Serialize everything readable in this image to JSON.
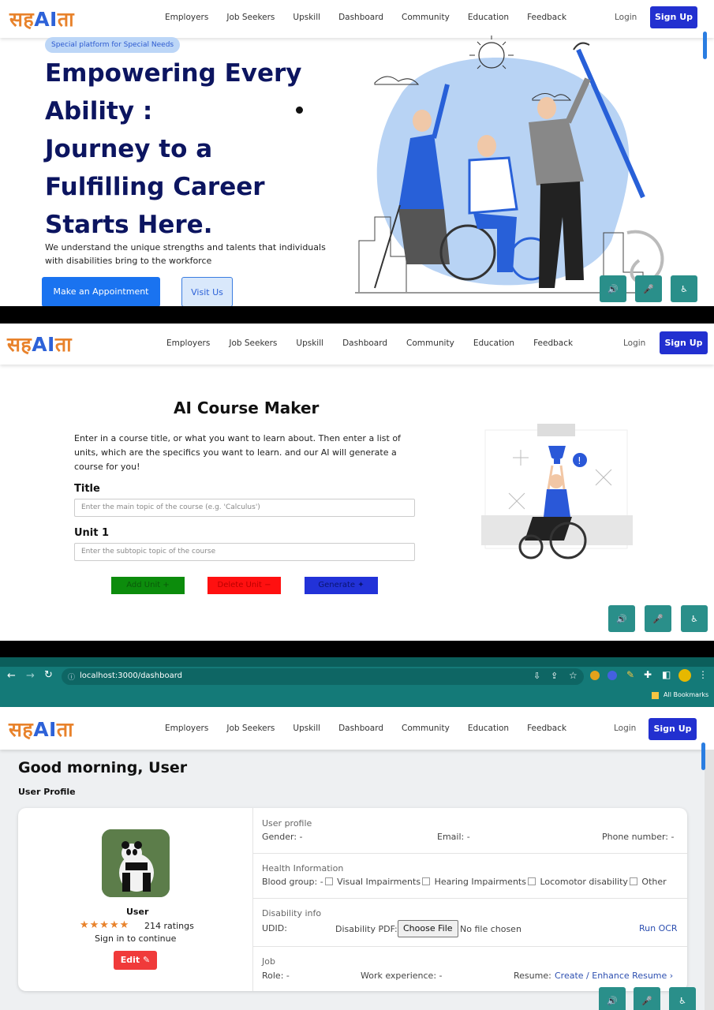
{
  "logo": {
    "part1": "सह",
    "part2": "AI",
    "part3": "ता"
  },
  "nav": {
    "items": [
      "Employers",
      "Job Seekers",
      "Upskill",
      "Dashboard",
      "Community",
      "Education",
      "Feedback"
    ],
    "login": "Login",
    "signup": "Sign Up"
  },
  "hero": {
    "badge": "Special platform for Special Needs",
    "title_lines": [
      "Empowering Every",
      "Ability :",
      "Journey to a",
      "Fulfilling Career",
      "Starts Here."
    ],
    "subtitle_line1": "We understand the unique strengths and talents that individuals",
    "subtitle_line2": "with disabilities bring to the workforce",
    "cta_primary": "Make an Appointment",
    "cta_secondary": "Visit Us"
  },
  "course_maker": {
    "heading": "AI Course Maker",
    "desc_line1": "Enter in a course title, or what you want to learn about. Then enter a list of",
    "desc_line2": "units, which are the specifics you want to learn. and our AI will generate a",
    "desc_line3": "course for you!",
    "title_label": "Title",
    "title_placeholder": "Enter the main topic of the course (e.g. 'Calculus')",
    "unit_label": "Unit 1",
    "unit_placeholder": "Enter the subtopic topic of the course",
    "add_unit": "Add Unit",
    "delete_unit": "Delete Unit",
    "generate": "Generate",
    "colors": {
      "add": "#0c8c0c",
      "delete": "#ff1010",
      "generate": "#2232d8"
    }
  },
  "browser": {
    "url": "localhost:3000/dashboard",
    "bookmarks": "All Bookmarks"
  },
  "dashboard": {
    "greeting": "Good morning, User",
    "profile_heading": "User Profile",
    "user_name": "User",
    "stars": "★★★★★",
    "ratings": "214 ratings",
    "sign_in": "Sign in to continue",
    "edit": "Edit",
    "sections": {
      "profile": {
        "title": "User profile",
        "gender": "Gender: -",
        "email": "Email: -",
        "phone": "Phone number: -"
      },
      "health": {
        "title": "Health Information",
        "blood": "Blood group: -",
        "visual": "Visual Impairments",
        "hearing": "Hearing Impairments",
        "locomotor": "Locomotor disability",
        "other": "Other"
      },
      "disability": {
        "title": "Disability info",
        "udid": "UDID:",
        "pdf": "Disability PDF:",
        "choose": "Choose File",
        "nofile": "No file chosen",
        "ocr": "Run OCR"
      },
      "job": {
        "title": "Job",
        "role": "Role: -",
        "experience": "Work experience: -",
        "resume": "Resume:",
        "resume_link": "Create / Enhance Resume ›"
      }
    }
  }
}
